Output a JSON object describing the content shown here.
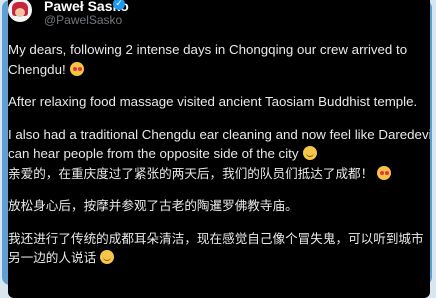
{
  "tweet": {
    "author_name": "Paweł Sasko",
    "handle": "@PawelSasko",
    "verified_icon": "✓",
    "lines": [
      {
        "text": "My dears, following 2 intense days in Chongqing our crew arrived to"
      },
      {
        "text": "Chengdu!",
        "emoji": "smiling-face-with-hearts"
      },
      {
        "text": "After relaxing food massage visited ancient Taosiam Buddhist temple."
      },
      {
        "text": "I also had a traditional Chengdu ear cleaning and now feel like Daredevil,"
      },
      {
        "text": "can hear people from the opposite side of the city",
        "emoji": "relieved-face"
      },
      {
        "text": "亲爱的，在重庆度过了紧张的两天后，我们的队员们抵达了成都！",
        "emoji": "smiling-face-with-hearts"
      },
      {
        "text": "放松身心后，按摩并参观了古老的陶暹罗佛教寺庙。"
      },
      {
        "text": "我还进行了传统的成都耳朵清洁，现在感觉自己像个冒失鬼，可以听到城市"
      },
      {
        "text": "另一边的人说话",
        "emoji": "relieved-face"
      }
    ]
  },
  "colors": {
    "background": "#000000",
    "text": "#e7e9ea",
    "muted": "#71767b",
    "frame_accent": "#5f9fd4",
    "verified": "#1d9bf0"
  }
}
